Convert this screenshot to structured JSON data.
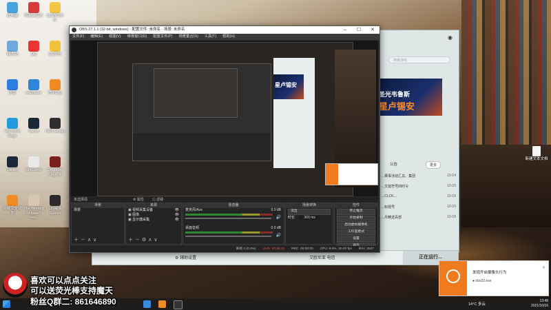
{
  "desktop": {
    "icons": [
      {
        "label": "此电脑",
        "color": "#4aa3df"
      },
      {
        "label": "网易云音乐",
        "color": "#d93a3a"
      },
      {
        "label": "QQ游戏大厅",
        "color": "#f4c542"
      },
      {
        "label": "回收站",
        "color": "#6fa8dc"
      },
      {
        "label": "QQ",
        "color": "#e33"
      },
      {
        "label": "QQ音乐",
        "color": "#f3c23c"
      },
      {
        "label": "迅雷",
        "color": "#2a7de1"
      },
      {
        "label": "wallpaper",
        "color": "#2f86d8"
      },
      {
        "label": "腾讯QQ",
        "color": "#f08a24"
      },
      {
        "label": "Microsoft Edge",
        "color": "#1f9bde"
      },
      {
        "label": "Steam",
        "color": "#1b2838"
      },
      {
        "label": "OBS Studio",
        "color": "#2e2e2e"
      },
      {
        "label": "Steam",
        "color": "#1b2838"
      },
      {
        "label": "WeGame",
        "color": "#e8e8e8"
      },
      {
        "label": "Crusader Kings III",
        "color": "#7a2020"
      },
      {
        "label": "火绒安全软件",
        "color": "#f08a24"
      },
      {
        "label": "The Binding of Isaac: Re...",
        "color": "#d9c6b0"
      },
      {
        "label": "Draw & Guess",
        "color": "#2b2b2b"
      }
    ],
    "right_file_label": "新建文本文档"
  },
  "obs": {
    "title": "OBS 27.1.1 (32-bit, windows) - 配置文件: 未命名 - 场景: 未命名",
    "menu": [
      "文件(F)",
      "编辑(E)",
      "视图(V)",
      "停靠窗口(D)",
      "配置文件(P)",
      "场景集合(S)",
      "工具(T)",
      "帮助(H)"
    ],
    "source_bar_label": "未选择源",
    "source_bar_buttons": [
      "属性",
      "滤镜"
    ],
    "docks": {
      "scenes": {
        "title": "场景",
        "items": [
          "场景"
        ]
      },
      "sources": {
        "title": "来源",
        "items": [
          "视频采集设备",
          "图像",
          "显示器采集"
        ]
      },
      "mixer": {
        "title": "混音器",
        "channels": [
          {
            "name": "麦克风/Aux",
            "db": "0.0 dB"
          },
          {
            "name": "桌面音频",
            "db": "0.0 dB"
          }
        ]
      },
      "transitions": {
        "title": "场景转换",
        "type": "淡出",
        "duration_label": "时长",
        "duration": "300 ms"
      },
      "controls": {
        "title": "控件",
        "buttons": [
          "停止推流",
          "开始录制",
          "启动虚拟摄像机",
          "工作室模式",
          "设置",
          "退出"
        ]
      }
    },
    "status": {
      "dropped": "丢帧 0 (0.0%)",
      "live": "LIVE: 00:38:21",
      "rec": "REC: 00:00:00",
      "cpu": "CPU: 8.6%, 30.00 fps",
      "bitrate": "kb/s: 2527"
    }
  },
  "launcher": {
    "search_placeholder": "搜索游戏",
    "banner_line1": "圣光韦鲁斯",
    "banner_line2": "星卢锡安",
    "notice_label": "公告",
    "more_label": "更多",
    "news": [
      {
        "title": "...赛事活动汇总、集团",
        "date": "10-14"
      },
      {
        "title": "...文能符号四时令",
        "date": "10-15"
      },
      {
        "title": "...CLCK...",
        "date": "10-15"
      },
      {
        "title": "...标题号",
        "date": "10-15"
      },
      {
        "title": "...月精选百部",
        "date": "10-15"
      }
    ],
    "bottom_news": "更多"
  },
  "strip": {
    "left_label": "辅助设置",
    "server": "艾欧尼亚 电信",
    "running": "正在运行..."
  },
  "toast": {
    "title": "发现开启摄像头行为",
    "process": "obs32.exe"
  },
  "overlay": {
    "line1": "喜欢可以点点关注",
    "line2": "可以送荧光棒支持魔天",
    "line3": "粉丝Q群二: 861646890"
  },
  "taskbar": {
    "weather": "14°C 多云",
    "time": "13:48",
    "date": "2021/10/16"
  }
}
